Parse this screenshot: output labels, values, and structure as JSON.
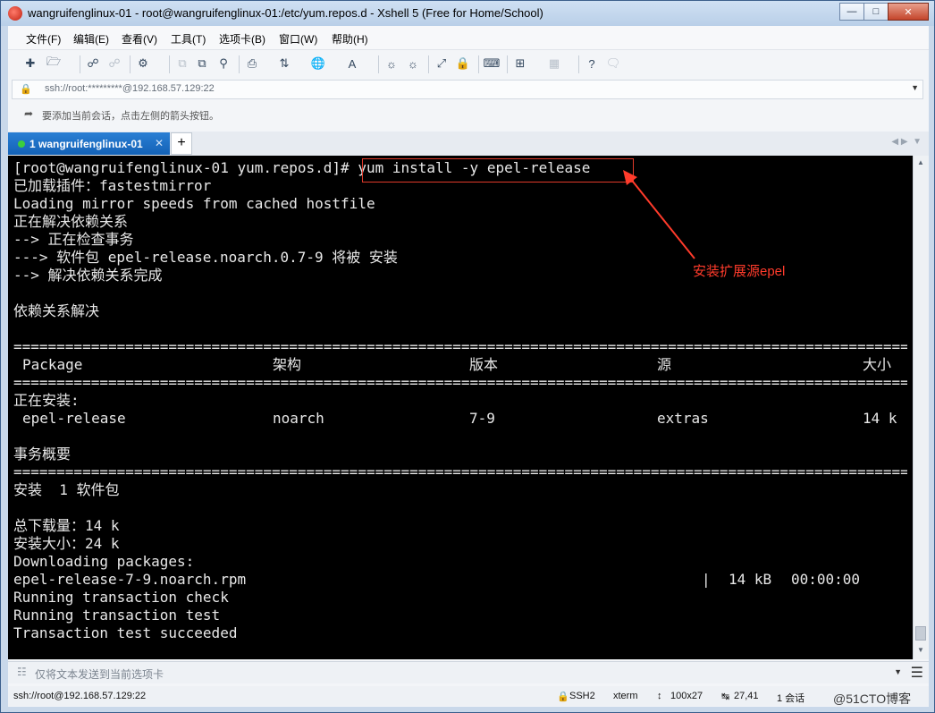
{
  "window": {
    "title": "wangruifenglinux-01 - root@wangruifenglinux-01:/etc/yum.repos.d - Xshell 5 (Free for Home/School)"
  },
  "menu": [
    "文件(F)",
    "编辑(E)",
    "查看(V)",
    "工具(T)",
    "选项卡(B)",
    "窗口(W)",
    "帮助(H)"
  ],
  "address": {
    "text": "ssh://root:*********@192.168.57.129:22"
  },
  "hint": {
    "text": "要添加当前会话，点击左侧的箭头按钮。"
  },
  "tab": {
    "label": "1 wangruifenglinux-01"
  },
  "terminal": {
    "prompt": "[root@wangruifenglinux-01 yum.repos.d]#",
    "command": " yum install -y epel-release",
    "lines": [
      "已加载插件：fastestmirror",
      "Loading mirror speeds from cached hostfile",
      "正在解决依赖关系",
      "--> 正在检查事务",
      "---> 软件包 epel-release.noarch.0.7-9 将被 安装",
      "--> 解决依赖关系完成",
      "依赖关系解决"
    ],
    "table": {
      "headers": [
        "Package",
        "架构",
        "版本",
        "源",
        "大小"
      ],
      "installing_label": "正在安装:",
      "row": [
        "epel-release",
        "noarch",
        "7-9",
        "extras",
        "14 k"
      ]
    },
    "summary_title": "事务概要",
    "lines2": [
      "安装  1 软件包",
      "总下载量：14 k",
      "安装大小：24 k",
      "Downloading packages:"
    ],
    "download": {
      "file": "epel-release-7-9.noarch.rpm",
      "bar": "|",
      "size": "14 kB",
      "time": "00:00:00"
    },
    "lines3": [
      "Running transaction check",
      "Running transaction test",
      "Transaction test succeeded"
    ],
    "separator": "=========================================================================================================================================================="
  },
  "annotation": {
    "text": "安装扩展源epel",
    "color": "#ff3b2b"
  },
  "sendbar": {
    "placeholder": "仅将文本发送到当前选项卡"
  },
  "status": {
    "address": "ssh://root@192.168.57.129:22",
    "protocol": "SSH2",
    "term": "xterm",
    "size": "100x27",
    "cursor": "27,41",
    "sessions": "1 会话"
  },
  "watermark": "@51CTO博客"
}
